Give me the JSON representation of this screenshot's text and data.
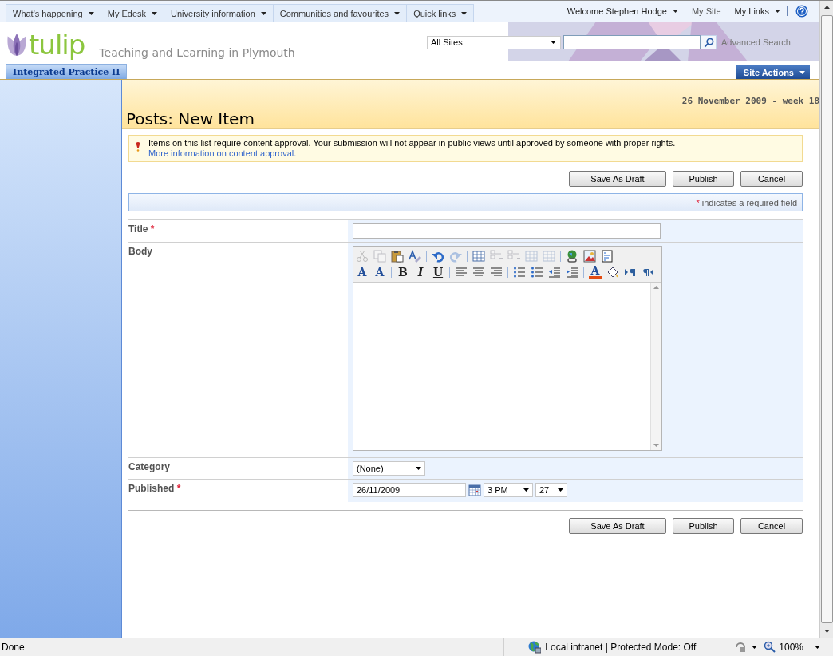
{
  "top_nav": [
    {
      "label": "What's happening"
    },
    {
      "label": "My Edesk"
    },
    {
      "label": "University information"
    },
    {
      "label": "Communities and favourites"
    },
    {
      "label": "Quick links"
    }
  ],
  "user_links": [
    {
      "label": "Welcome Stephen Hodge",
      "menu": true
    },
    {
      "label": "My Site",
      "menu": false
    },
    {
      "label": "My Links",
      "menu": true
    }
  ],
  "logo": {
    "word": "tulip",
    "tagline": "Teaching and Learning in Plymouth"
  },
  "search": {
    "scope": "All Sites",
    "advanced": "Advanced Search"
  },
  "site_tab": "Integrated Practice II",
  "site_actions": "Site Actions",
  "date": "26 November 2009 - week 18",
  "page_title": "Posts: New Item",
  "notice": {
    "text": "Items on this list require content approval. Your submission will not appear in public views until approved by someone with proper rights.",
    "link": "More information on content approval."
  },
  "buttons_top": [
    "Save As Draft",
    "Publish",
    "Cancel"
  ],
  "required_note": {
    "mark": "*",
    "text": "indicates a required field"
  },
  "fields": [
    {
      "label": "Title",
      "required": true,
      "kind": "text"
    },
    {
      "label": "Body",
      "required": false,
      "kind": "rich"
    },
    {
      "label": "Category",
      "required": false,
      "kind": "select",
      "value": "(None)"
    },
    {
      "label": "Published",
      "required": true,
      "kind": "datetime",
      "date": "26/11/2009",
      "hour": "3 PM",
      "minute": "27"
    }
  ],
  "toolbar": [
    [
      {
        "kind": "tool",
        "disabled": true
      },
      {
        "kind": "tool",
        "disabled": true
      },
      {
        "kind": "tool",
        "disabled": false
      },
      {
        "kind": "tool",
        "disabled": false
      },
      {
        "kind": "separator"
      },
      {
        "kind": "tool",
        "disabled": false
      },
      {
        "kind": "tool",
        "disabled": true
      },
      {
        "kind": "separator"
      },
      {
        "kind": "tool",
        "disabled": false
      },
      {
        "kind": "tool",
        "disabled": true
      },
      {
        "kind": "tool",
        "disabled": true
      },
      {
        "kind": "tool",
        "disabled": true
      },
      {
        "kind": "tool",
        "disabled": true
      },
      {
        "kind": "separator"
      },
      {
        "kind": "tool",
        "disabled": false
      },
      {
        "kind": "tool",
        "disabled": false
      },
      {
        "kind": "tool",
        "disabled": false
      }
    ],
    [
      {
        "kind": "letter",
        "label": "A"
      },
      {
        "kind": "letter",
        "label": "A"
      },
      {
        "kind": "separator"
      },
      {
        "kind": "letter",
        "label": "B"
      },
      {
        "kind": "letter",
        "label": "I"
      },
      {
        "kind": "letter",
        "label": "U"
      },
      {
        "kind": "separator"
      },
      {
        "kind": "tool",
        "disabled": false
      },
      {
        "kind": "tool",
        "disabled": false
      },
      {
        "kind": "tool",
        "disabled": false
      },
      {
        "kind": "separator"
      },
      {
        "kind": "tool",
        "disabled": false
      },
      {
        "kind": "tool",
        "disabled": false
      },
      {
        "kind": "tool",
        "disabled": false
      },
      {
        "kind": "tool",
        "disabled": false
      },
      {
        "kind": "separator"
      },
      {
        "kind": "letter",
        "label": "A"
      },
      {
        "kind": "tool",
        "disabled": false
      },
      {
        "kind": "tool",
        "disabled": false
      },
      {
        "kind": "tool",
        "disabled": false
      }
    ]
  ],
  "buttons_bottom": [
    "Save As Draft",
    "Publish",
    "Cancel"
  ],
  "status_bar": {
    "text": "Done",
    "zone": "Local intranet | Protected Mode: Off",
    "zoom": "100%"
  }
}
